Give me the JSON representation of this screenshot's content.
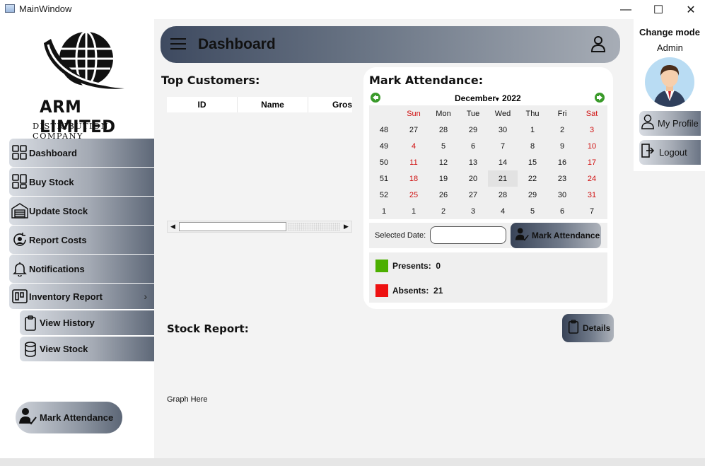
{
  "window": {
    "title": "MainWindow",
    "minimize": "—",
    "maximize": "☐",
    "close": "✕"
  },
  "logo": {
    "brand": "ARM LIMITED",
    "tagline": "DISTRIBUTION COMPANY"
  },
  "sidebar": {
    "items": [
      {
        "label": "Dashboard",
        "icon": "grid-icon"
      },
      {
        "label": "Buy Stock",
        "icon": "grid-icon"
      },
      {
        "label": "Update Stock",
        "icon": "warehouse-icon"
      },
      {
        "label": "Report Costs",
        "icon": "cost-icon"
      },
      {
        "label": "Notifications",
        "icon": "bell-icon"
      },
      {
        "label": "Inventory Report",
        "icon": "board-icon",
        "chevron": "›"
      }
    ],
    "subitems": [
      {
        "label": "View History",
        "icon": "clipboard-icon"
      },
      {
        "label": "View Stock",
        "icon": "database-icon"
      }
    ],
    "mark_attendance": "Mark Attendance"
  },
  "header": {
    "title": "Dashboard"
  },
  "top_customers": {
    "title": "Top Customers:",
    "columns": [
      "ID",
      "Name",
      "Gross"
    ]
  },
  "attendance": {
    "title": "Mark Attendance:",
    "calendar": {
      "month": "December",
      "year": "2022",
      "weekdays": [
        "Sun",
        "Mon",
        "Tue",
        "Wed",
        "Thu",
        "Fri",
        "Sat"
      ],
      "weeks": [
        {
          "wk": "48",
          "days": [
            "27",
            "28",
            "29",
            "30",
            "1",
            "2",
            "3"
          ]
        },
        {
          "wk": "49",
          "days": [
            "4",
            "5",
            "6",
            "7",
            "8",
            "9",
            "10"
          ]
        },
        {
          "wk": "50",
          "days": [
            "11",
            "12",
            "13",
            "14",
            "15",
            "16",
            "17"
          ]
        },
        {
          "wk": "51",
          "days": [
            "18",
            "19",
            "20",
            "21",
            "22",
            "23",
            "24"
          ]
        },
        {
          "wk": "52",
          "days": [
            "25",
            "26",
            "27",
            "28",
            "29",
            "30",
            "31"
          ]
        },
        {
          "wk": "1",
          "days": [
            "1",
            "2",
            "3",
            "4",
            "5",
            "6",
            "7"
          ]
        }
      ],
      "selected_day": "21"
    },
    "selected_date_label": "Selected Date:",
    "selected_date_value": "",
    "button": "Mark Attendance",
    "presents_label": "Presents:",
    "presents_value": "0",
    "absents_label": "Absents:",
    "absents_value": "21",
    "present_color": "#4caf00",
    "absent_color": "#ee1111"
  },
  "stock_report": {
    "title": "Stock Report:",
    "details_button": "Details",
    "graph_placeholder": "Graph Here"
  },
  "profile_panel": {
    "change_mode": "Change mode",
    "role": "Admin",
    "my_profile": "My Profile",
    "logout": "Logout"
  }
}
